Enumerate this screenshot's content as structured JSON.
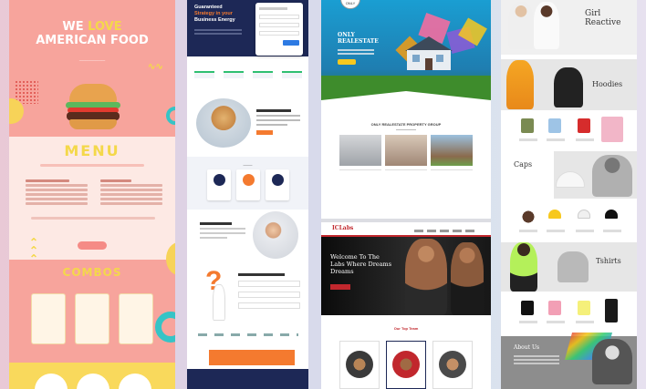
{
  "food": {
    "hero_line1_pre": "WE ",
    "hero_line1_hl": "LOVE",
    "hero_line2": "AMERICAN FOOD",
    "menu_title": "MENU",
    "combos_title": "COMBOS",
    "colors": {
      "bg": "#f7a49c",
      "accent": "#f4d84a"
    }
  },
  "business": {
    "headline_1": "Guaranteed",
    "headline_2": "Strategy in your",
    "headline_3": "Business Energy",
    "colors": {
      "navy": "#1d2856",
      "accent": "#f47a2f"
    }
  },
  "realestate": {
    "logo": "ONLY",
    "title_1": "ONLY",
    "title_2": "REALESTATE",
    "section_title": "ONLY REALESTATE PROPERTY GROUP"
  },
  "gym": {
    "logo": "ICLabs",
    "headline_1": "Welcome To The",
    "headline_2": "Labs Where Dreams",
    "headline_3": "Dreams",
    "team_title": "Our Top Team",
    "colors": {
      "accent": "#c1272d"
    }
  },
  "clothing": {
    "brand_1": "Girl",
    "brand_2": "Reactive",
    "hoodies": "Hoodies",
    "caps": "Caps",
    "tshirts": "Tshirts",
    "about": "About Us"
  }
}
